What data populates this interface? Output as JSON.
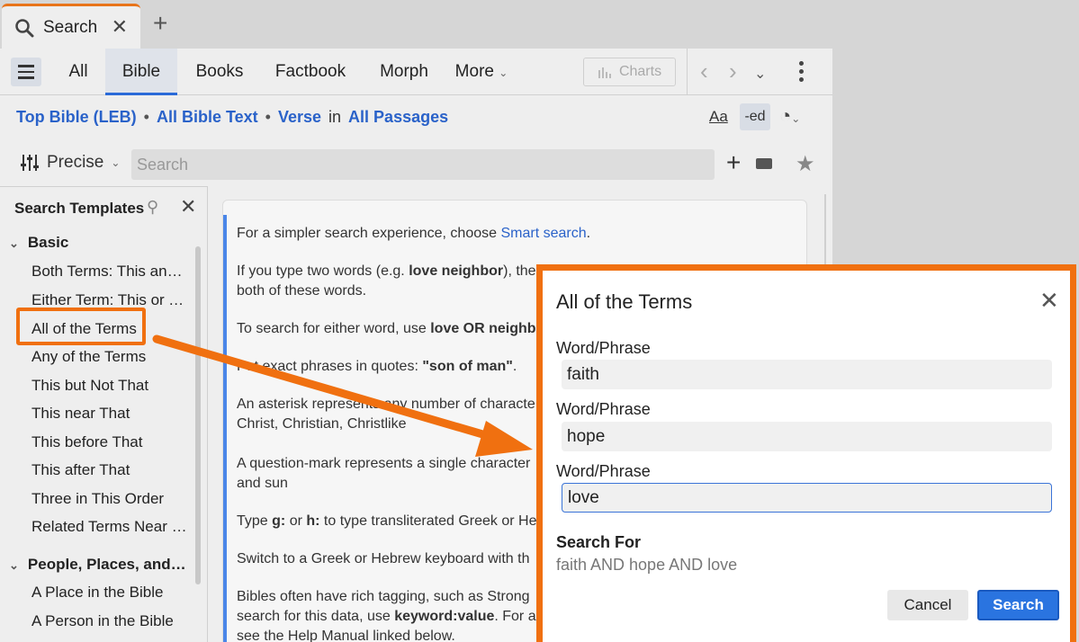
{
  "tab": {
    "label": "Search",
    "close": "✕",
    "new_tab": "+"
  },
  "toolbar": {
    "tabs": [
      "All",
      "Bible",
      "Books",
      "Factbook",
      "Morph"
    ],
    "more": "More",
    "charts": "Charts",
    "active_tab": "Bible"
  },
  "scope": {
    "bible": "Top Bible (LEB)",
    "dot": "•",
    "text": "All Bible Text",
    "unit": "Verse",
    "in": "in",
    "passages": "All Passages",
    "aa": "Aa",
    "ed": "-ed"
  },
  "search": {
    "mode": "Precise",
    "placeholder": "Search"
  },
  "sidebar": {
    "header": "Search Templates",
    "groups": [
      {
        "label": "Basic",
        "items": [
          "Both Terms: This and That",
          "Either Term: This or That",
          "All of the Terms",
          "Any of the Terms",
          "This but Not That",
          "This near That",
          "This before That",
          "This after That",
          "Three in This Order",
          "Related Terms Near Each Other"
        ]
      },
      {
        "label": "People, Places, and Things",
        "items": [
          "A Place in the Bible",
          "A Person in the Bible"
        ]
      }
    ]
  },
  "content": {
    "p1_pre": "For a simpler search experience, choose ",
    "p1_link": "Smart search",
    "p1_post": ".",
    "p2a": "If you type two words (e.g. ",
    "p2b": "love neighbor",
    "p2c": "), the",
    "p2d": "both of these words.",
    "p3a": "To search for either word, use ",
    "p3b": "love OR neighb",
    "p4a": "Put exact phrases in quotes: ",
    "p4b": "\"son of man\"",
    "p4c": ".",
    "p5a": "An asterisk represents any number of characte",
    "p5b": "Christ, Christian, Christlike",
    "p6a": "A question-mark represents a single character",
    "p6b": "and sun",
    "p7a": "Type ",
    "p7b": "g:",
    "p7c": " or ",
    "p7d": "h:",
    "p7e": " to type transliterated Greek or He",
    "p8": "Switch to a Greek or Hebrew keyboard with th",
    "p9a": "Bibles often have rich tagging, such as Strong",
    "p9b": "search for this data, use ",
    "p9c": "keyword:value",
    "p9d": ". For a",
    "p9e": "see the Help Manual linked below."
  },
  "dialog": {
    "title": "All of the Terms",
    "field_label": "Word/Phrase",
    "fields": [
      "faith",
      "hope",
      "love"
    ],
    "search_for_label": "Search For",
    "search_for_value": "faith AND hope AND love",
    "cancel": "Cancel",
    "search": "Search"
  },
  "colors": {
    "accent": "#f07010",
    "link": "#2a62c9",
    "primary_button": "#2a74e0"
  }
}
